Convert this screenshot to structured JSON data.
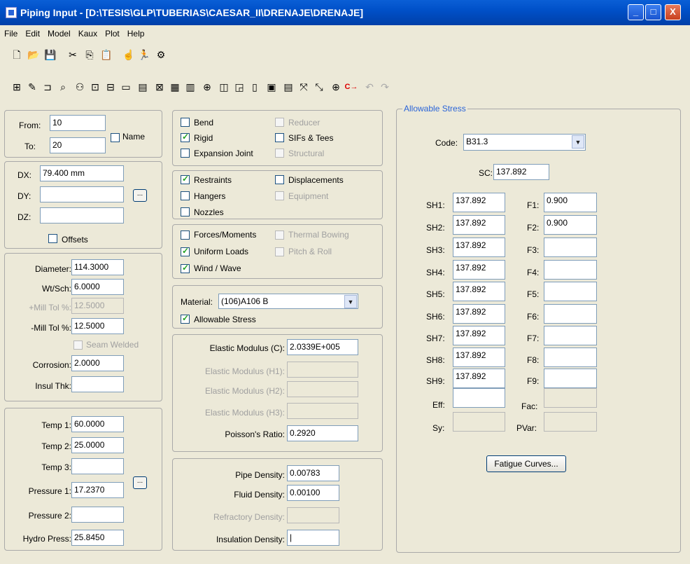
{
  "window": {
    "title": "Piping Input - [D:\\TESIS\\GLP\\TUBERIAS\\CAESAR_II\\DRENAJE\\DRENAJE]",
    "min": "_",
    "max": "□",
    "close": "X"
  },
  "menu": [
    "File",
    "Edit",
    "Model",
    "Kaux",
    "Plot",
    "Help"
  ],
  "toolbar1": [
    "new-icon",
    "open-icon",
    "save-icon",
    "cut-icon",
    "copy-icon",
    "paste-icon",
    "hand-icon",
    "walk-icon",
    "batch-run-icon"
  ],
  "toolbar1_glyphs": [
    "🗋",
    "📂",
    "💾",
    "✂",
    "⎘",
    "📋",
    "☝",
    "🏃",
    "⚙"
  ],
  "toolbar2_glyphs": [
    "⊞",
    "✎",
    "⊐",
    "⌕",
    "⚇",
    "⊡",
    "⊟",
    "▭",
    "▤",
    "⊠",
    "▦",
    "▥",
    "⊕",
    "◫",
    "◲",
    "▯",
    "▣",
    "▤",
    "⤧",
    "⤡",
    "⊕",
    "C→",
    "↶",
    "↷"
  ],
  "nodes": {
    "from_label": "From:",
    "from": "10",
    "to_label": "To:",
    "to": "20",
    "name_label": "Name"
  },
  "delta": {
    "dx_label": "DX:",
    "dx": "79.400 mm",
    "dy_label": "DY:",
    "dy": "",
    "dz_label": "DZ:",
    "dz": "",
    "offsets_label": "Offsets",
    "dots": "..."
  },
  "pipe": {
    "diameter_label": "Diameter:",
    "diameter": "114.3000",
    "wtsch_label": "Wt/Sch:",
    "wtsch": "6.0000",
    "millp_label": "+Mill Tol %:",
    "millp": "12.5000",
    "millm_label": "-Mill Tol %:",
    "millm": "12.5000",
    "seam_label": "Seam Welded",
    "corrosion_label": "Corrosion:",
    "corrosion": "2.0000",
    "insul_label": "Insul Thk:",
    "insul": ""
  },
  "temps": {
    "t1_label": "Temp 1:",
    "t1": "60.0000",
    "t2_label": "Temp 2:",
    "t2": "25.0000",
    "t3_label": "Temp 3:",
    "t3": "",
    "p1_label": "Pressure 1:",
    "p1": "17.2370",
    "p2_label": "Pressure 2:",
    "p2": "",
    "hydro_label": "Hydro Press:",
    "hydro": "25.8450",
    "dots": "..."
  },
  "options1": {
    "bend": "Bend",
    "reducer": "Reducer",
    "rigid": "Rigid",
    "sifs": "SIFs & Tees",
    "expansion": "Expansion Joint",
    "structural": "Structural"
  },
  "options2": {
    "restraints": "Restraints",
    "displacements": "Displacements",
    "hangers": "Hangers",
    "equipment": "Equipment",
    "nozzles": "Nozzles"
  },
  "options3": {
    "forces": "Forces/Moments",
    "thermal": "Thermal Bowing",
    "uniform": "Uniform Loads",
    "pitch": "Pitch & Roll",
    "wind": "Wind / Wave"
  },
  "material": {
    "label": "Material:",
    "value": "(106)A106 B",
    "allowable": "Allowable Stress"
  },
  "elastic": {
    "ec_label": "Elastic Modulus (C):",
    "ec": "2.0339E+005",
    "eh1_label": "Elastic Modulus (H1):",
    "eh2_label": "Elastic Modulus (H2):",
    "eh3_label": "Elastic Modulus (H3):",
    "poisson_label": "Poisson's Ratio:",
    "poisson": "0.2920"
  },
  "density": {
    "pipe_label": "Pipe Density:",
    "pipe": "0.00783",
    "fluid_label": "Fluid Density:",
    "fluid": "0.00100",
    "refr_label": "Refractory Density:",
    "insul_label": "Insulation Density:",
    "insul": "|"
  },
  "allow": {
    "title": "Allowable Stress",
    "code_label": "Code:",
    "code": "B31.3",
    "sc_label": "SC:",
    "sc": "137.892",
    "sh_labels": [
      "SH1:",
      "SH2:",
      "SH3:",
      "SH4:",
      "SH5:",
      "SH6:",
      "SH7:",
      "SH8:",
      "SH9:"
    ],
    "sh": [
      "137.892",
      "137.892",
      "137.892",
      "137.892",
      "137.892",
      "137.892",
      "137.892",
      "137.892",
      "137.892"
    ],
    "f_labels": [
      "F1:",
      "F2:",
      "F3:",
      "F4:",
      "F5:",
      "F6:",
      "F7:",
      "F8:",
      "F9:"
    ],
    "f": [
      "0.900",
      "0.900",
      "",
      "",
      "",
      "",
      "",
      "",
      ""
    ],
    "eff_label": "Eff:",
    "fac_label": "Fac:",
    "sy_label": "Sy:",
    "pvar_label": "PVar:",
    "fatigue": "Fatigue Curves..."
  }
}
